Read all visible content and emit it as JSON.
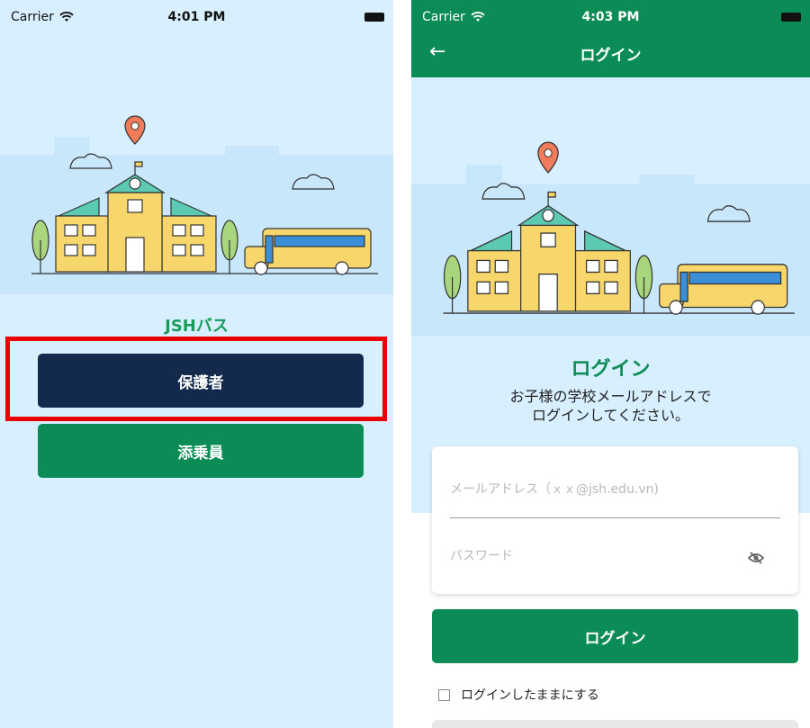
{
  "left_screen": {
    "status": {
      "carrier": "Carrier",
      "time": "4:01 PM"
    },
    "app_title": "JSHバス",
    "parent_button": "保護者",
    "attendant_button": "添乗員"
  },
  "right_screen": {
    "status": {
      "carrier": "Carrier",
      "time": "4:03 PM"
    },
    "appbar_title": "ログイン",
    "heading": "ログイン",
    "subtitle_line1": "お子様の学校メールアドレスで",
    "subtitle_line2": "ログインしてください。",
    "email_placeholder": "メールアドレス（ｘｘ@jsh.edu.vn)",
    "password_placeholder": "パスワード",
    "login_button": "ログイン",
    "remember_label": "ログインしたままにする"
  },
  "icons": [
    "wifi-icon",
    "battery-icon",
    "back-arrow-icon",
    "eye-off-icon",
    "map-pin-icon",
    "school-illustration",
    "bus-illustration",
    "cloud-icon",
    "tree-icon"
  ],
  "colors": {
    "brand_green": "#0b8c57",
    "navy": "#142a4d",
    "background": "#d7efff",
    "highlight": "#e80000"
  }
}
